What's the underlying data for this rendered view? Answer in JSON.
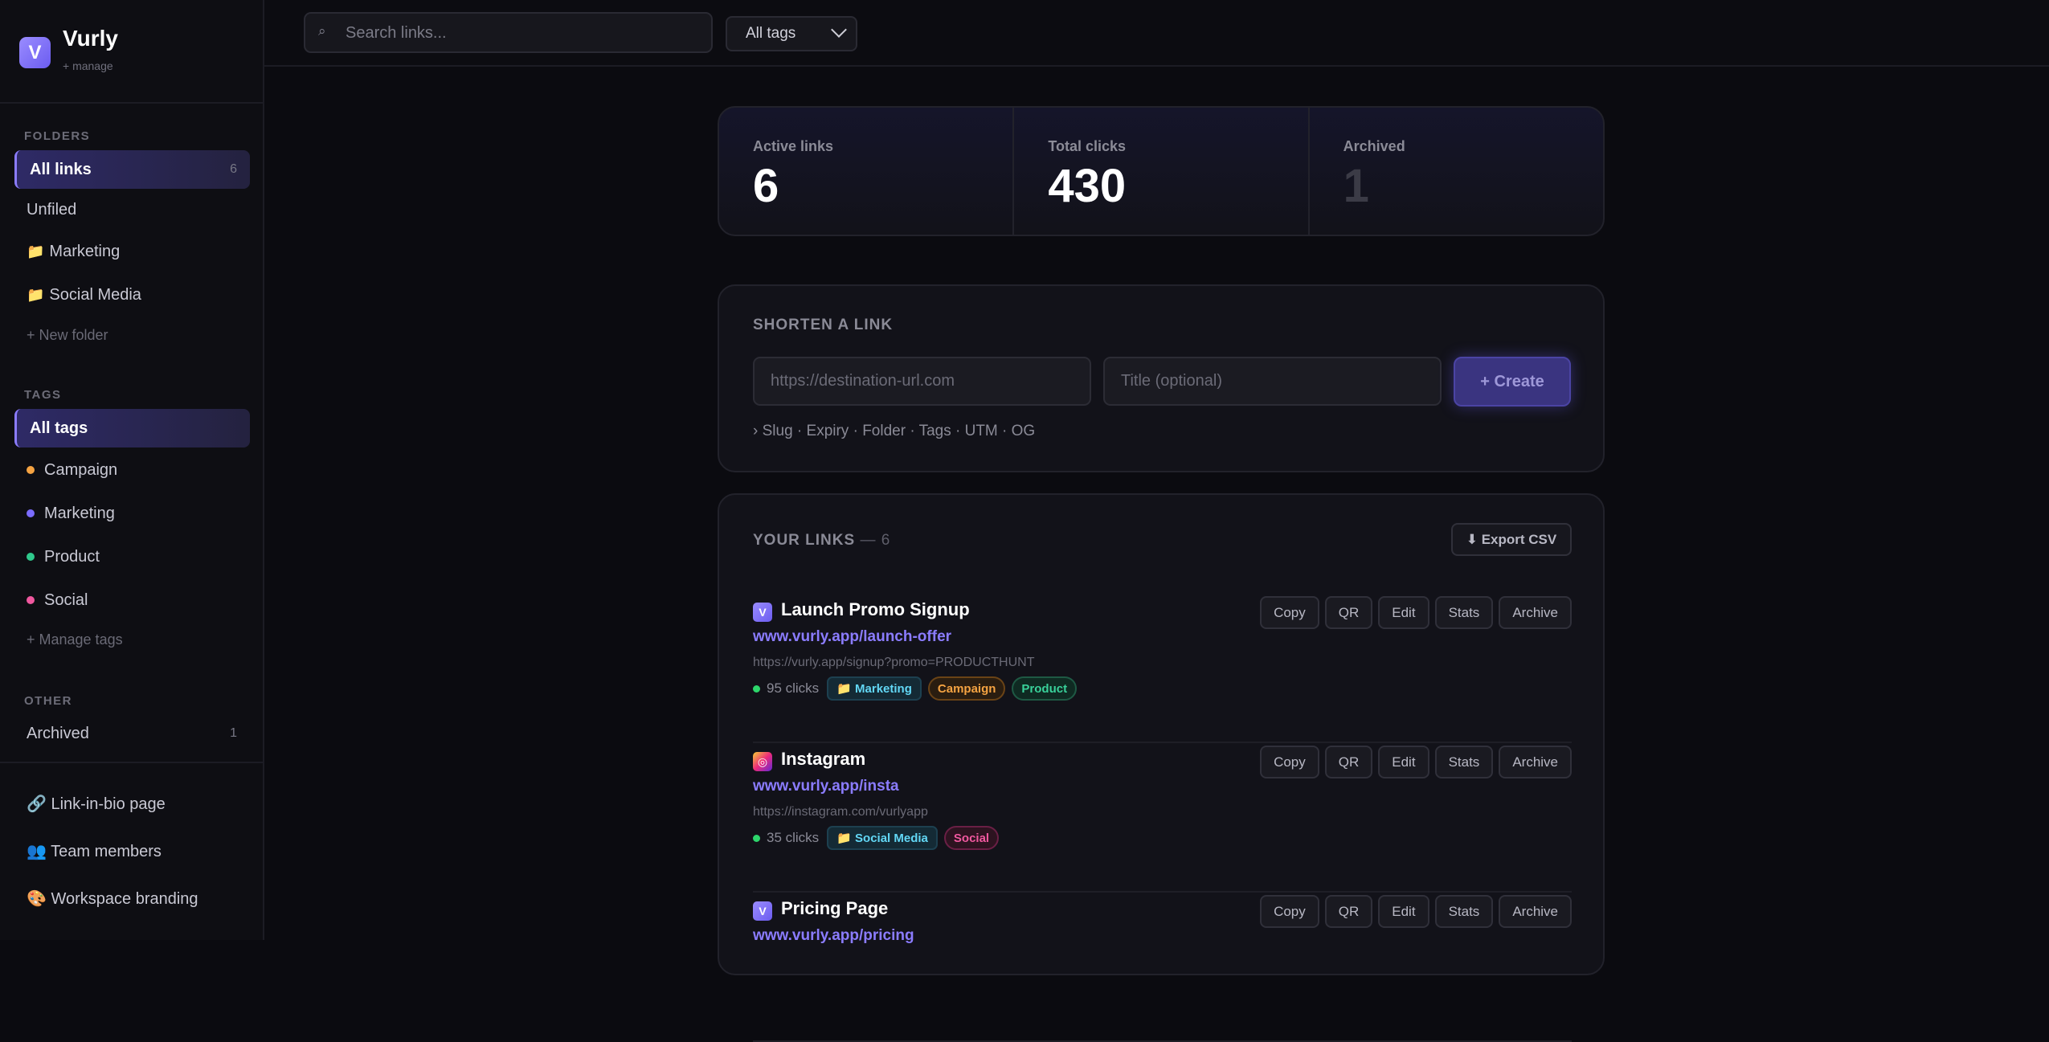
{
  "brand": {
    "logo": "V",
    "name": "Vurly",
    "sub": "+ manage"
  },
  "sidebar": {
    "folders_title": "FOLDERS",
    "folders": [
      {
        "label": "All links",
        "count": "6",
        "active": true
      },
      {
        "label": "Unfiled"
      },
      {
        "label": "Marketing",
        "icon": "folder-icon"
      },
      {
        "label": "Social Media",
        "icon": "folder-icon"
      }
    ],
    "new_folder": "+ New folder",
    "tags_title": "TAGS",
    "tags": [
      {
        "label": "All tags",
        "active": true
      },
      {
        "label": "Campaign",
        "color": "#f5a342"
      },
      {
        "label": "Marketing",
        "color": "#7b6cff"
      },
      {
        "label": "Product",
        "color": "#2fc98c"
      },
      {
        "label": "Social",
        "color": "#f0589f"
      }
    ],
    "manage_tags": "+ Manage tags",
    "other_title": "OTHER",
    "archived": {
      "label": "Archived",
      "count": "1"
    },
    "footer": [
      {
        "icon": "🔗",
        "label": "Link-in-bio page"
      },
      {
        "icon": "👥",
        "label": "Team members"
      },
      {
        "icon": "🎨",
        "label": "Workspace branding"
      }
    ]
  },
  "topbar": {
    "search_icon": "⌕",
    "search_placeholder": "Search links...",
    "tag_filter": "All tags"
  },
  "stats": [
    {
      "label": "Active links",
      "value": "6"
    },
    {
      "label": "Total clicks",
      "value": "430"
    },
    {
      "label": "Archived",
      "value": "1"
    }
  ],
  "shorten": {
    "title": "SHORTEN A LINK",
    "url_placeholder": "https://destination-url.com",
    "title_placeholder": "Title (optional)",
    "create": "+ Create",
    "options": "› Slug · Expiry · Folder · Tags · UTM · OG"
  },
  "links_section": {
    "title": "YOUR LINKS",
    "count": "— 6",
    "export": "⬇ Export CSV",
    "actions": [
      "Copy",
      "QR",
      "Edit",
      "Stats",
      "Archive"
    ],
    "items": [
      {
        "title": "Launch Promo Signup",
        "short": "www.vurly.app/launch-offer",
        "dest": "https://vurly.app/signup?promo=PRODUCTHUNT",
        "clicks": "95 clicks",
        "folder": "📁 Marketing",
        "tags": [
          "Campaign",
          "Product"
        ]
      },
      {
        "title": "Instagram",
        "short": "www.vurly.app/insta",
        "dest": "https://instagram.com/vurlyapp",
        "clicks": "35 clicks",
        "folder": "📁 Social Media",
        "tags": [
          "Social"
        ]
      },
      {
        "title": "Pricing Page",
        "short": "www.vurly.app/pricing",
        "dest": "",
        "clicks": "",
        "folder": "",
        "tags": []
      }
    ]
  }
}
